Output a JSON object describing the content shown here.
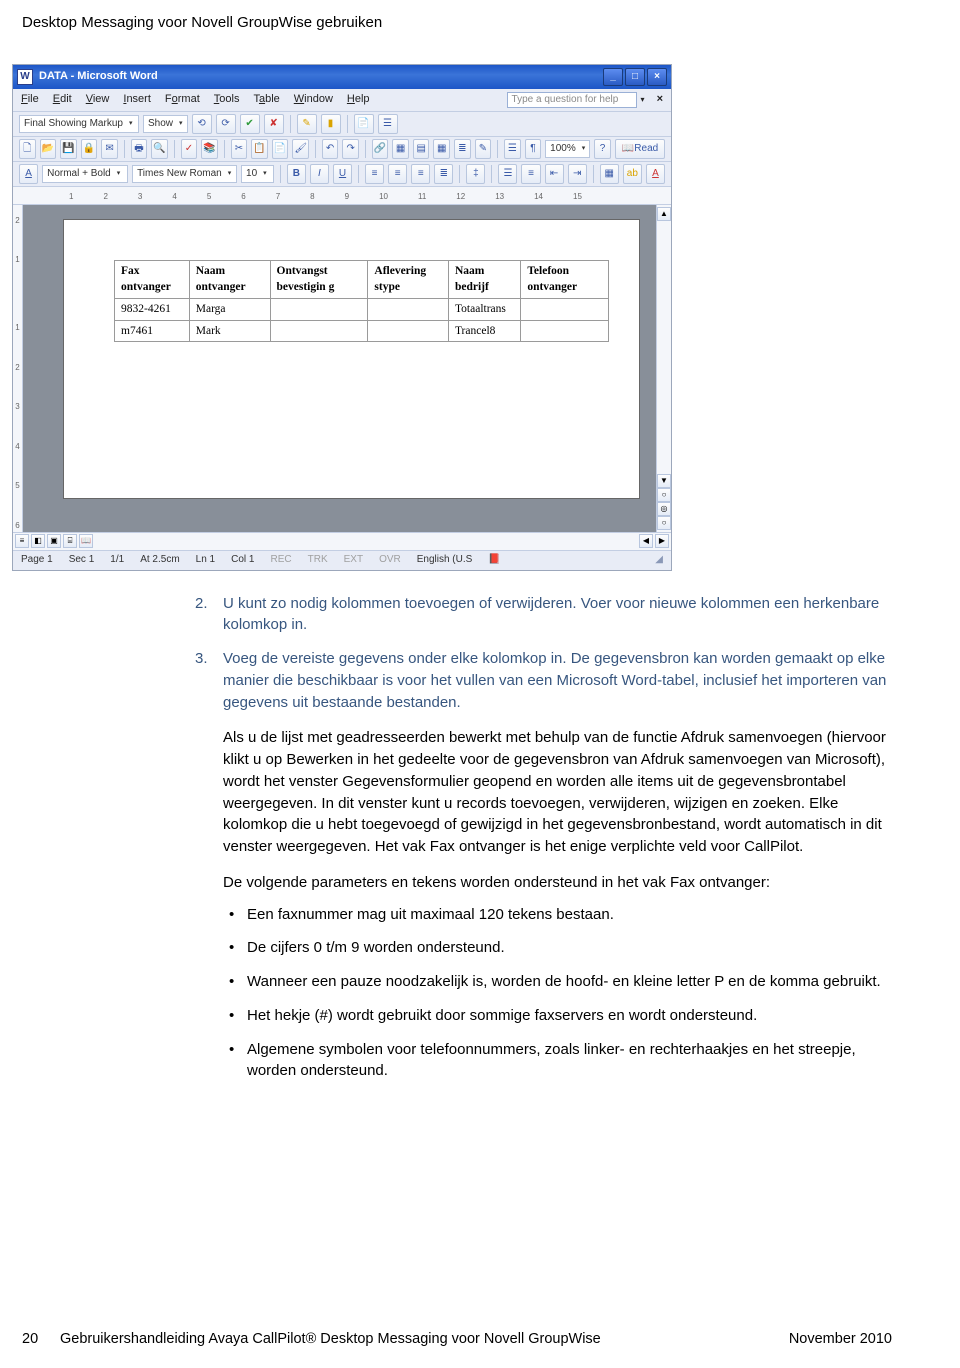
{
  "page_header": "Desktop Messaging voor Novell GroupWise gebruiken",
  "word": {
    "title": "DATA - Microsoft Word",
    "menus": [
      "File",
      "Edit",
      "View",
      "Insert",
      "Format",
      "Tools",
      "Table",
      "Window",
      "Help"
    ],
    "help_placeholder": "Type a question for help",
    "markup_label": "Final Showing Markup",
    "show_label": "Show",
    "style_label": "Normal + Bold",
    "font_label": "Times New Roman",
    "fontsize_label": "10",
    "zoom_label": "100%",
    "read_label": "Read",
    "ruler_marks": [
      "",
      "1",
      "2",
      "3",
      "4",
      "5",
      "6",
      "7",
      "8",
      "9",
      "10",
      "11",
      "12",
      "13",
      "14",
      "15"
    ],
    "vruler_marks": [
      "2",
      "1",
      "",
      "1",
      "2",
      "3",
      "4",
      "5",
      "6"
    ],
    "table": {
      "headers": [
        "Fax ontvanger",
        "Naam ontvanger",
        "Ontvangst bevestigin g",
        "Aflevering stype",
        "Naam bedrijf",
        "Telefoon ontvanger"
      ],
      "rows": [
        [
          "9832-4261",
          "Marga",
          "",
          "",
          "Totaaltrans",
          ""
        ],
        [
          "m7461",
          "Mark",
          "",
          "",
          "Trancel8",
          ""
        ]
      ]
    },
    "status": {
      "page": "Page 1",
      "sec": "Sec 1",
      "pages": "1/1",
      "at": "At 2.5cm",
      "ln": "Ln 1",
      "col": "Col 1",
      "rec": "REC",
      "trk": "TRK",
      "ext": "EXT",
      "ovr": "OVR",
      "lang": "English (U.S"
    }
  },
  "content": {
    "item2_num": "2.",
    "item2": "U kunt zo nodig kolommen toevoegen of verwijderen. Voer voor nieuwe kolommen een herkenbare kolomkop in.",
    "item3_num": "3.",
    "item3": "Voeg de vereiste gegevens onder elke kolomkop in. De gegevensbron kan worden gemaakt op elke manier die beschikbaar is voor het vullen van een Microsoft Word-tabel, inclusief het importeren van gegevens uit bestaande bestanden.",
    "item3_p2": "Als u de lijst met geadresseerden bewerkt met behulp van de functie Afdruk samenvoegen (hiervoor klikt u op Bewerken in het gedeelte voor de gegevensbron van Afdruk samenvoegen van Microsoft), wordt het venster Gegevensformulier geopend en worden alle items uit de gegevensbrontabel weergegeven. In dit venster kunt u records toevoegen, verwijderen, wijzigen en zoeken. Elke kolomkop die u hebt toegevoegd of gewijzigd in het gegevensbronbestand, wordt automatisch in dit venster weergegeven. Het vak Fax ontvanger is het enige verplichte veld voor CallPilot.",
    "item3_p3": "De volgende parameters en tekens worden ondersteund in het vak Fax ontvanger:",
    "bullets": [
      "Een faxnummer mag uit maximaal 120 tekens bestaan.",
      "De cijfers 0 t/m 9 worden ondersteund.",
      "Wanneer een pauze noodzakelijk is, worden de hoofd- en kleine letter P en de komma gebruikt.",
      "Het hekje (#) wordt gebruikt door sommige faxservers en wordt ondersteund.",
      "Algemene symbolen voor telefoonnummers, zoals linker- en rechterhaakjes en het streepje, worden ondersteund."
    ]
  },
  "footer": {
    "page": "20",
    "title": "Gebruikershandleiding Avaya CallPilot® Desktop Messaging voor Novell GroupWise",
    "date": "November 2010"
  }
}
